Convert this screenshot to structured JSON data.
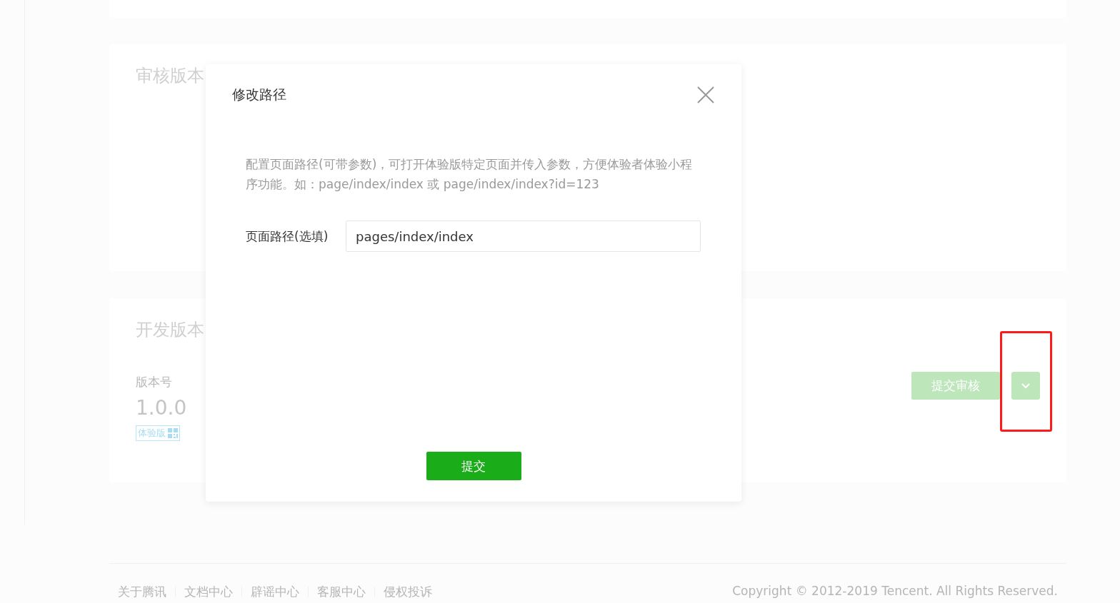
{
  "review_section": {
    "title": "审核版本"
  },
  "dev_section": {
    "title": "开发版本",
    "version_label": "版本号",
    "version": "1.0.0",
    "tag": "体验版",
    "submit_button": "提交审核"
  },
  "footer": {
    "links": [
      "关于腾讯",
      "文档中心",
      "辟谣中心",
      "客服中心",
      "侵权投诉"
    ],
    "copyright": "Copyright © 2012-2019 Tencent. All Rights Reserved."
  },
  "dialog": {
    "title": "修改路径",
    "description": "配置页面路径(可带参数)，可打开体验版特定页面并传入参数，方便体验者体验小程序功能。如：page/index/index 或 page/index/index?id=123",
    "field": {
      "label": "页面路径(选填)",
      "value": "pages/index/index"
    },
    "submit_button": "提交"
  }
}
